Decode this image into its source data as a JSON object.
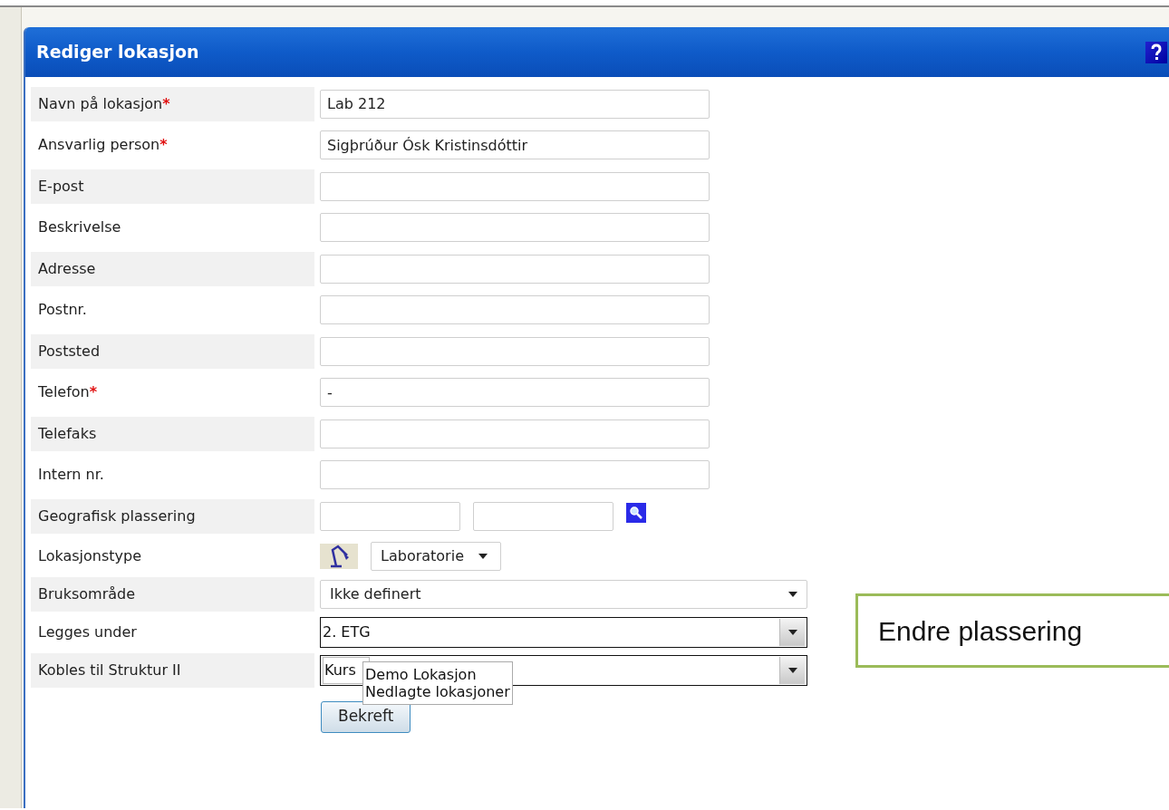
{
  "dialog": {
    "title": "Rediger lokasjon"
  },
  "fields": [
    {
      "kind": "text",
      "label": "Navn på lokasjon",
      "required_marker": "*",
      "value": "Lab 212"
    },
    {
      "kind": "text",
      "label": "Ansvarlig person",
      "required_marker": "*",
      "value": "Sigþrúður Ósk Kristinsdóttir"
    },
    {
      "kind": "text",
      "label": "E-post"
    },
    {
      "kind": "text",
      "label": "Beskrivelse"
    },
    {
      "kind": "text",
      "label": "Adresse"
    },
    {
      "kind": "text",
      "label": "Postnr."
    },
    {
      "kind": "text",
      "label": "Poststed"
    },
    {
      "kind": "text",
      "label": "Telefon",
      "required_marker": "*",
      "value": "-"
    },
    {
      "kind": "text",
      "label": "Telefaks"
    },
    {
      "kind": "text",
      "label": "Intern nr."
    },
    {
      "kind": "coords",
      "label": "Geografisk plassering"
    },
    {
      "kind": "typeselect",
      "label": "Lokasjonstype",
      "value": "Laboratorie"
    },
    {
      "kind": "select",
      "label": "Bruksområde",
      "value": "Ikke definert"
    },
    {
      "kind": "combo",
      "label": "Legges under",
      "value": "2. ETG"
    },
    {
      "kind": "combo",
      "label": "Kobles til Struktur II",
      "value": "Kurs",
      "dropdown_options": [
        "Demo Lokasjon",
        "Nedlagte lokasjoner"
      ]
    }
  ],
  "submit_button": "Bekreft",
  "callout": "Endre plassering"
}
